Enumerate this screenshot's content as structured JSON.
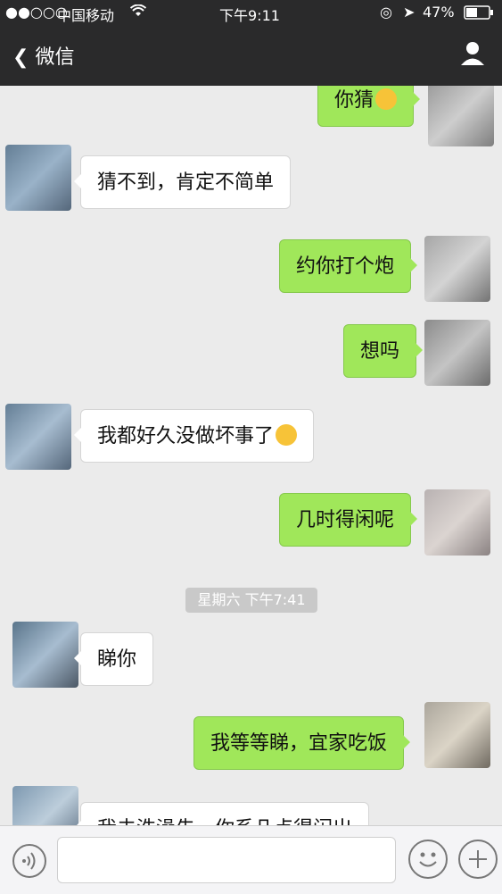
{
  "status_bar": {
    "signal": "●●○○○",
    "carrier": "中国移动",
    "time": "下午9:11",
    "battery": "47%"
  },
  "nav": {
    "back_label": "微信",
    "title": ""
  },
  "messages": [
    {
      "side": "right",
      "text": "你猜",
      "emoji": "grinning-squint-icon"
    },
    {
      "side": "left",
      "text": "猜不到，肯定不简单"
    },
    {
      "side": "right",
      "text": "约你打个炮"
    },
    {
      "side": "right",
      "text": "想吗"
    },
    {
      "side": "left",
      "text": "我都好久没做坏事了",
      "emoji": "grimace-icon"
    },
    {
      "side": "right",
      "text": "几时得闲呢"
    },
    {
      "side": "left",
      "text": "睇你"
    },
    {
      "side": "right",
      "text": "我等等睇，宜家吃饭"
    },
    {
      "side": "left",
      "text": "我去洗澡先，你系几点得闲出"
    }
  ],
  "timestamp": "星期六 下午7:41",
  "input": {
    "placeholder": ""
  },
  "colors": {
    "header_bg": "#2a2a2b",
    "chat_bg": "#ebebeb",
    "bubble_sent": "#a0e75a",
    "bubble_received": "#ffffff"
  }
}
